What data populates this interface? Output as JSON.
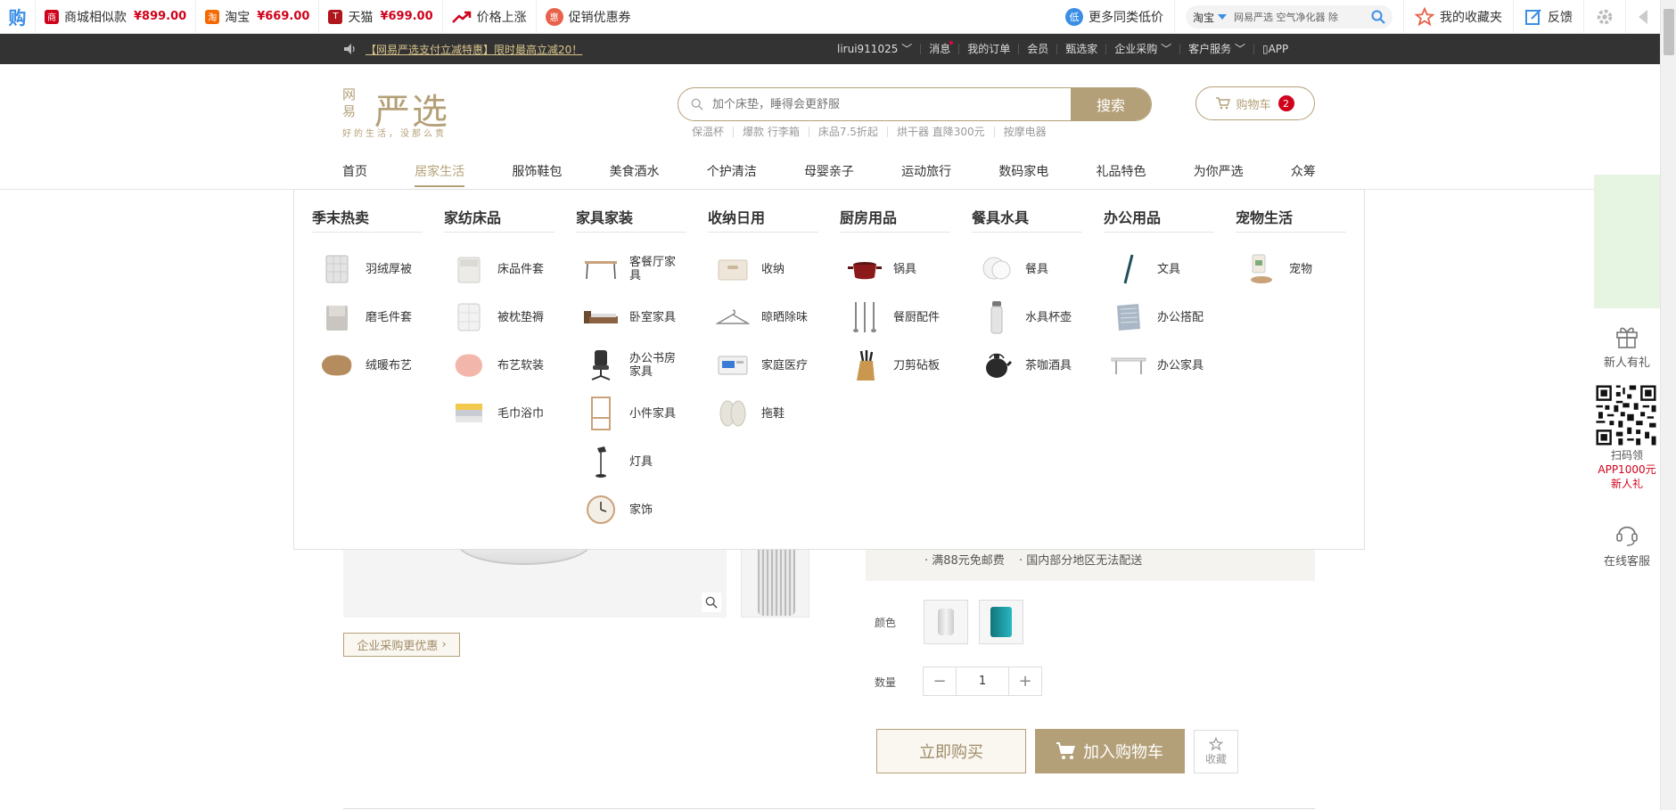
{
  "plugin": {
    "logo": "购",
    "compare": [
      {
        "icon": "商",
        "label": "商城相似款",
        "price": "¥899.00",
        "color": "#d0021b"
      },
      {
        "icon": "淘",
        "label": "淘宝",
        "price": "¥669.00",
        "color": "#f56a00"
      },
      {
        "icon": "T",
        "label": "天猫",
        "price": "¥699.00",
        "color": "#b0161b"
      }
    ],
    "price_up": "价格上涨",
    "coupon": "促销优惠券",
    "coupon_icon": "惠",
    "low_icon": "低",
    "more_low": "更多同类低价",
    "search_source": "淘宝",
    "search_text": "网易严选 空气净化器 除",
    "favorites": "我的收藏夹",
    "feedback": "反馈"
  },
  "topbar": {
    "promo": "【网易严选支付立减特惠】限时最高立减20！",
    "links": [
      {
        "label": "lirui911025",
        "caret": true
      },
      {
        "label": "消息",
        "dot": true
      },
      {
        "label": "我的订单"
      },
      {
        "label": "会员"
      },
      {
        "label": "甄选家"
      },
      {
        "label": "企业采购",
        "caret": true
      },
      {
        "label": "客户服务",
        "caret": true
      },
      {
        "label": "APP",
        "phone": true
      }
    ]
  },
  "header": {
    "logo_small": "网易",
    "logo_main": "严选",
    "slogan": "好的生活，没那么贵",
    "search_placeholder": "加个床垫，睡得会更舒服",
    "search_button": "搜索",
    "hot_words": [
      "保温杯",
      "爆款 行李箱",
      "床品7.5折起",
      "烘干器 直降300元",
      "按摩电器"
    ],
    "cart_label": "购物车",
    "cart_count": "2"
  },
  "nav": [
    {
      "label": "首页"
    },
    {
      "label": "居家生活",
      "active": true
    },
    {
      "label": "服饰鞋包"
    },
    {
      "label": "美食酒水"
    },
    {
      "label": "个护清洁"
    },
    {
      "label": "母婴亲子"
    },
    {
      "label": "运动旅行"
    },
    {
      "label": "数码家电"
    },
    {
      "label": "礼品特色"
    },
    {
      "label": "为你严选"
    },
    {
      "label": "众筹"
    }
  ],
  "dropdown": [
    {
      "title": "季末热卖",
      "items": [
        {
          "name": "羽绒厚被",
          "icon": "quilt-icon"
        },
        {
          "name": "磨毛件套",
          "icon": "bedding-icon"
        },
        {
          "name": "绒暖布艺",
          "icon": "fur-rug-icon"
        }
      ]
    },
    {
      "title": "家纺床品",
      "items": [
        {
          "name": "床品件套",
          "icon": "bedding-set-icon"
        },
        {
          "name": "被枕垫褥",
          "icon": "pillow-icon"
        },
        {
          "name": "布艺软装",
          "icon": "pink-rug-icon"
        },
        {
          "name": "毛巾浴巾",
          "icon": "towel-icon"
        }
      ]
    },
    {
      "title": "家具家装",
      "items": [
        {
          "name": "客餐厅家具",
          "icon": "table-icon"
        },
        {
          "name": "卧室家具",
          "icon": "bed-icon"
        },
        {
          "name": "办公书房家具",
          "icon": "office-chair-icon"
        },
        {
          "name": "小件家具",
          "icon": "shelf-icon"
        },
        {
          "name": "灯具",
          "icon": "lamp-icon"
        },
        {
          "name": "家饰",
          "icon": "clock-icon"
        }
      ]
    },
    {
      "title": "收纳日用",
      "items": [
        {
          "name": "收纳",
          "icon": "storage-box-icon"
        },
        {
          "name": "晾晒除味",
          "icon": "hanger-icon"
        },
        {
          "name": "家庭医疗",
          "icon": "medical-icon"
        },
        {
          "name": "拖鞋",
          "icon": "slippers-icon"
        }
      ]
    },
    {
      "title": "厨房用品",
      "items": [
        {
          "name": "锅具",
          "icon": "pot-icon"
        },
        {
          "name": "餐厨配件",
          "icon": "utensils-icon"
        },
        {
          "name": "刀剪砧板",
          "icon": "knife-block-icon"
        }
      ]
    },
    {
      "title": "餐具水具",
      "items": [
        {
          "name": "餐具",
          "icon": "plates-icon"
        },
        {
          "name": "水具杯壶",
          "icon": "bottle-icon"
        },
        {
          "name": "茶咖酒具",
          "icon": "teapot-icon"
        }
      ]
    },
    {
      "title": "办公用品",
      "items": [
        {
          "name": "文具",
          "icon": "pen-icon"
        },
        {
          "name": "办公搭配",
          "icon": "notebook-icon"
        },
        {
          "name": "办公家具",
          "icon": "desk-icon"
        }
      ]
    },
    {
      "title": "宠物生活",
      "items": [
        {
          "name": "宠物",
          "icon": "pet-icon"
        }
      ]
    }
  ],
  "product": {
    "biz_button": "企业采购更优惠",
    "shipping": "满88元免邮费",
    "region": "国内部分地区无法配送",
    "color_label": "颜色",
    "qty_label": "数量",
    "qty_value": "1",
    "buy_now": "立即购买",
    "add_cart": "加入购物车",
    "favorite": "收藏"
  },
  "float_bar": {
    "gift": "新人有礼",
    "qr_line1": "扫码领",
    "qr_line2": "APP1000元",
    "qr_line3": "新人礼",
    "service": "在线客服"
  }
}
